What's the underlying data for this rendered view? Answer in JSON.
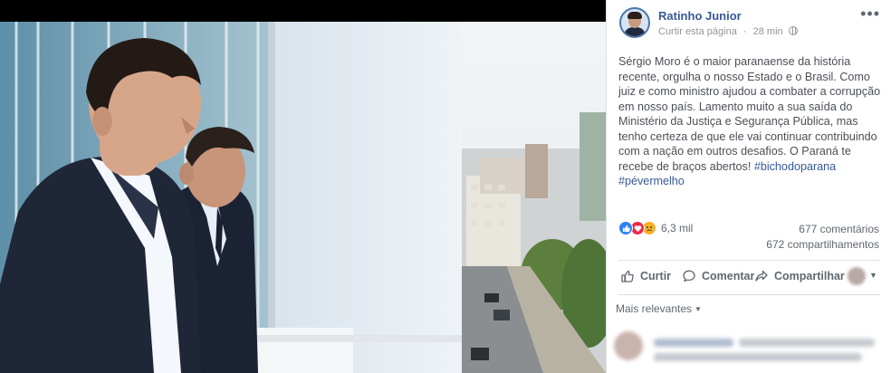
{
  "post": {
    "author": "Ratinho Junior",
    "follow_link": "Curtir esta página",
    "separator": "·",
    "time": "28 min",
    "visibility_icon": "globe-icon",
    "more_icon": "more-options-icon",
    "text": "Sérgio Moro é o maior paranaense da história recente, orgulha o nosso Estado e o Brasil. Como juiz e como ministro ajudou a combater a corrupção em nosso país. Lamento muito a sua saída do Ministério da Justiça e Segurança Pública, mas tenho certeza de que ele vai continuar contribuindo com a nação em outros desafios. O Paraná te recebe de braços abertos!",
    "hashtag1": "#bichodoparana",
    "hashtag2": "#pévermelho"
  },
  "stats": {
    "reactions_count": "6,3 mil",
    "reaction_icons": [
      "like-icon",
      "love-icon",
      "sad-icon"
    ],
    "comments": "677 comentários",
    "shares": "672 compartilhamentos"
  },
  "actions": {
    "like": "Curtir",
    "comment": "Comentar",
    "share": "Compartilhar"
  },
  "comments_section": {
    "sort_label": "Mais relevantes"
  },
  "colors": {
    "link_blue": "#365899",
    "text_gray": "#606770",
    "body_text": "#4b4f56",
    "like_blue": "#2e81f4",
    "love_red": "#f0284a",
    "sad_yellow": "#f7b125"
  }
}
